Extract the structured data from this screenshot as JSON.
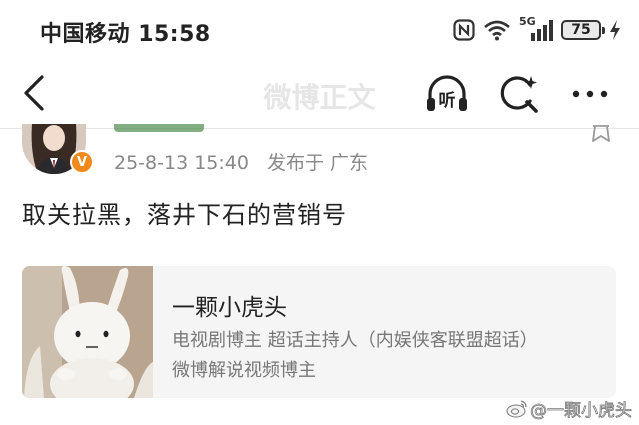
{
  "status_bar": {
    "carrier": "中国移动",
    "time": "15:58",
    "network": "5G",
    "battery": "75"
  },
  "nav": {
    "title": "微博正文",
    "listen_label": "听"
  },
  "post": {
    "timestamp": "25-8-13 15:40",
    "source": "发布于 广东",
    "text": "取关拉黑，落井下石的营销号"
  },
  "card": {
    "name": "一颗小虎头",
    "desc_line1": "电视剧博主 超话主持人（内娱侠客联盟超话）",
    "desc_line2": "微博解说视频博主"
  },
  "watermark": {
    "text": "@一颗小虎头"
  },
  "colors": {
    "verified_badge": "#f08a1c",
    "meta_text": "#888888",
    "card_background": "#f5f5f5"
  }
}
